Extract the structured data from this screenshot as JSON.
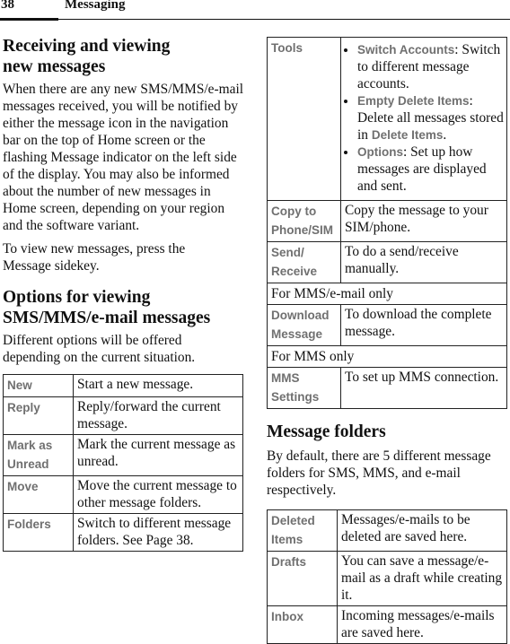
{
  "header": {
    "page_number": "38",
    "section": "Messaging"
  },
  "left": {
    "heading1": "Receiving and viewing new messages",
    "para1": "When there are any new SMS/MMS/e-mail messages received, you will be notified by either the message icon in the navigation bar on the top of Home screen or the flashing Message indicator on the left side of the display. You may also be informed about the number of new messages in Home screen, depending on your region and the software variant.",
    "para2": "To view new messages, press the Message sidekey.",
    "heading2": "Options for viewing SMS/MMS/e-mail messages",
    "para3": "Different options will be offered depending on the current situation.",
    "options_table": [
      {
        "term": "New",
        "desc": "Start a new message."
      },
      {
        "term": "Reply",
        "desc": "Reply/forward the current message."
      },
      {
        "term": "Mark as Unread",
        "desc": "Mark the current message as unread."
      },
      {
        "term": "Move",
        "desc": "Move the current message to other message folders."
      },
      {
        "term": "Folders",
        "desc": "Switch to different message folders. See Page 38."
      }
    ]
  },
  "right": {
    "tools": {
      "term": "Tools",
      "items": [
        {
          "key": "Switch Accounts",
          "text": ": Switch to different message accounts."
        },
        {
          "key": "Empty Delete Items",
          "text": ": Delete all messages stored in ",
          "key2": "Delete Items",
          "text2": "."
        },
        {
          "key": "Options",
          "text": ": Set up how messages are displayed and sent."
        }
      ]
    },
    "rows": [
      {
        "term": "Copy to Phone/SIM",
        "desc": "Copy the message to your SIM/phone."
      },
      {
        "term": "Send/ Receive",
        "desc": "To do a send/receive manually."
      }
    ],
    "section_mms_email": "For MMS/e-mail only",
    "download": {
      "term": "Download Message",
      "desc": "To download the complete message."
    },
    "section_mms": "For MMS only",
    "mms_settings": {
      "term": "MMS Settings",
      "desc": "To set up MMS connection."
    },
    "heading3": "Message folders",
    "para4": "By default, there are 5 different message folders for SMS, MMS, and e-mail respectively.",
    "folders_table": [
      {
        "term": "Deleted Items",
        "desc": "Messages/e-mails to be deleted are saved here."
      },
      {
        "term": "Drafts",
        "desc": "You can save a message/e-mail as a draft while creating it."
      },
      {
        "term": "Inbox",
        "desc": "Incoming messages/e-mails are saved here."
      }
    ]
  }
}
